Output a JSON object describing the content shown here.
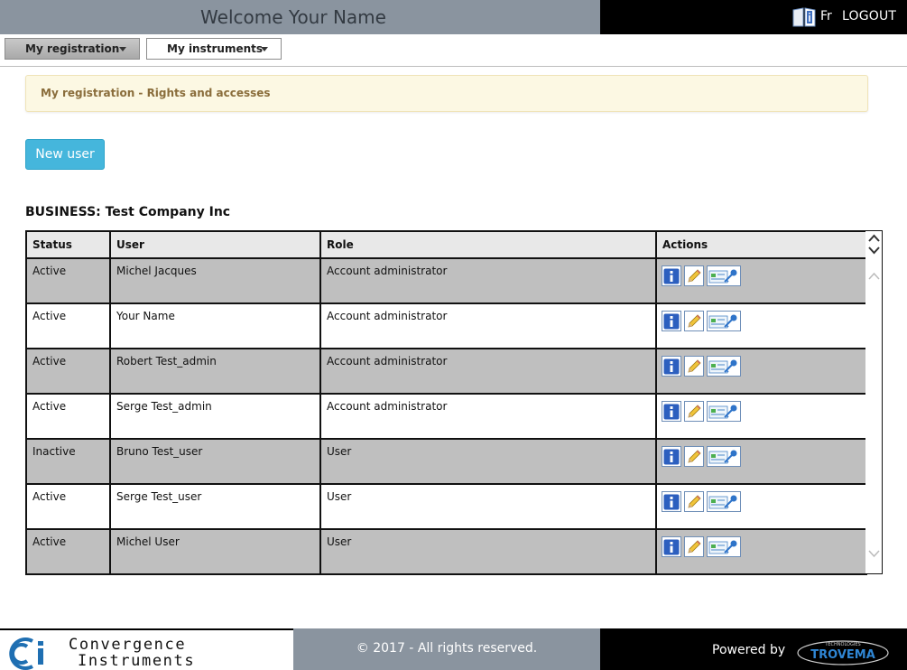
{
  "header": {
    "welcome": "Welcome  Your Name",
    "lang": "Fr",
    "logout": "LOGOUT"
  },
  "menu": {
    "items": [
      {
        "label": "My registration"
      },
      {
        "label": "My instruments"
      }
    ]
  },
  "notice": {
    "text": "My registration - Rights and accesses"
  },
  "actions": {
    "new_user": "New user"
  },
  "business": {
    "title": "BUSINESS: Test Company Inc"
  },
  "table": {
    "columns": [
      "Status",
      "User",
      "Role",
      "Actions"
    ],
    "rows": [
      {
        "status": "Active",
        "user": "Michel Jacques",
        "role": "Account administrator"
      },
      {
        "status": "Active",
        "user": "Your Name",
        "role": "Account administrator"
      },
      {
        "status": "Active",
        "user": "Robert Test_admin",
        "role": "Account administrator"
      },
      {
        "status": "Active",
        "user": "Serge Test_admin",
        "role": "Account administrator"
      },
      {
        "status": "Inactive",
        "user": "Bruno Test_user",
        "role": "User"
      },
      {
        "status": "Active",
        "user": "Serge Test_user",
        "role": "User"
      },
      {
        "status": "Active",
        "user": "Michel User",
        "role": "User"
      }
    ]
  },
  "footer": {
    "brand_line1": "Convergence",
    "brand_line2": "Instruments",
    "copyright": "© 2017 - All rights reserved.",
    "powered_by": "Powered by",
    "trovema_small": "TECHNOLOGIES",
    "trovema": "TROVEMA"
  },
  "colors": {
    "header_gray": "#8a949f",
    "header_black": "#000000",
    "notice_bg": "#fcf8e3",
    "notice_text": "#8a6d3b",
    "button_blue": "#45b6dc",
    "row_gray": "#bfbfbf"
  }
}
